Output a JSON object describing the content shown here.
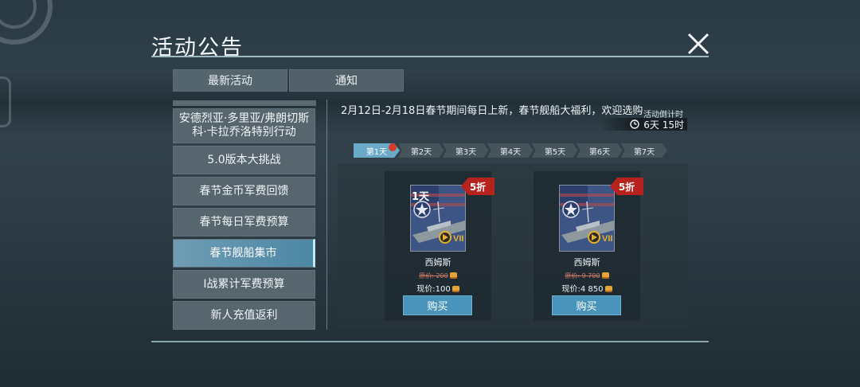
{
  "header": {
    "title": "活动公告"
  },
  "tabs": [
    {
      "label": "最新活动"
    },
    {
      "label": "通知"
    }
  ],
  "sidebar": {
    "items": [
      {
        "label": "安德烈亚·多里亚/弗朗切斯科·卡拉乔洛特别行动"
      },
      {
        "label": "5.0版本大挑战"
      },
      {
        "label": "春节金币军费回馈"
      },
      {
        "label": "春节每日军费预算"
      },
      {
        "label": "春节舰船集市"
      },
      {
        "label": "I战累计军费预算"
      },
      {
        "label": "新人充值返利"
      }
    ],
    "active_index": 4
  },
  "main": {
    "headline": "2月12日-2月18日春节期间每日上新，春节舰船大福利，欢迎选购",
    "countdown": {
      "label": "活动倒计时",
      "value": "6天 15时"
    },
    "days": [
      "第1天",
      "第2天",
      "第3天",
      "第4天",
      "第5天",
      "第6天",
      "第7天"
    ],
    "active_day": 0,
    "cards": [
      {
        "days_badge": "1天",
        "discount": "5折",
        "ship_name": "西姆斯",
        "original_price": "原价: 200",
        "current_price": "现价:100",
        "buy_label": "购买",
        "tier": "VII"
      },
      {
        "days_badge": "",
        "discount": "5折",
        "ship_name": "西姆斯",
        "original_price": "原价: 9 700",
        "current_price": "现价:4 850",
        "buy_label": "购买",
        "tier": "VII"
      }
    ]
  },
  "colors": {
    "accent": "#4a93ba",
    "discount": "#b8221c",
    "active_tab": "#6aa9c8",
    "notify_dot": "#d63a2c"
  }
}
